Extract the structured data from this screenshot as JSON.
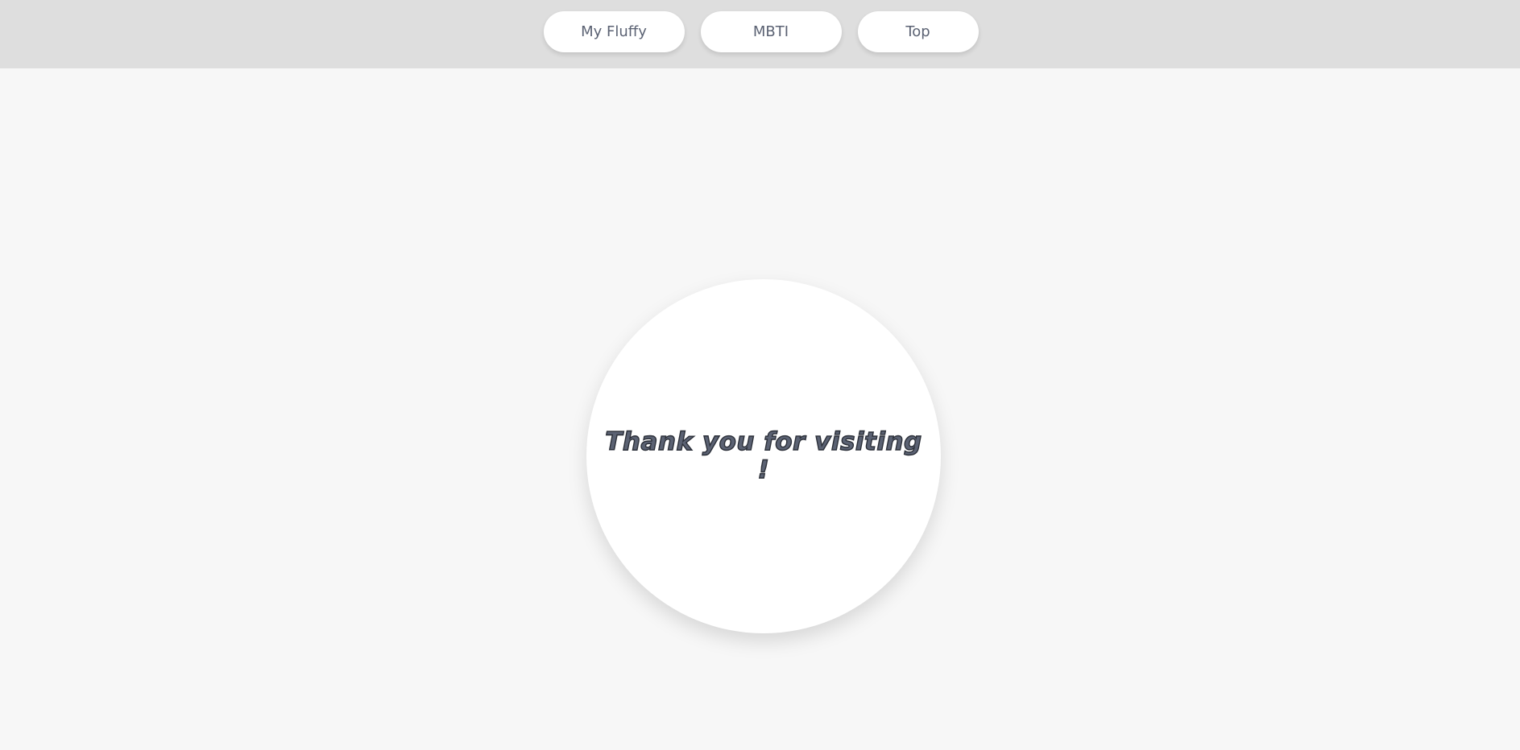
{
  "nav": {
    "items": [
      {
        "label": "My Fluffy"
      },
      {
        "label": "MBTI"
      },
      {
        "label": "Top"
      }
    ]
  },
  "main": {
    "message": "Thank you for visiting !"
  },
  "colors": {
    "header_bg": "#dedede",
    "page_bg": "#f7f7f7",
    "text": "#5b6273",
    "text_outline": "#2b2f38"
  }
}
